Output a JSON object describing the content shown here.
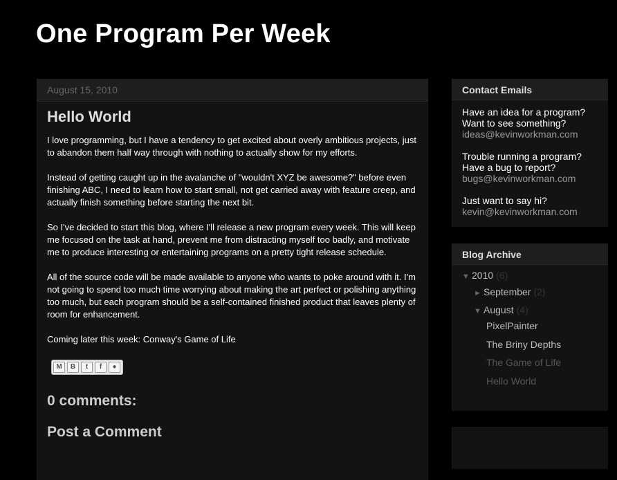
{
  "blog": {
    "title": "One Program Per Week"
  },
  "post": {
    "date": "August 15, 2010",
    "title": "Hello World",
    "paragraphs": [
      "I love programming, but I have a tendency to get excited about overly ambitious projects, just to abandon them half way through with nothing to actually show for my efforts.",
      "Instead of getting caught up in the avalanche of \"wouldn't XYZ be awesome?\" before even finishing ABC, I need to learn how to start small, not get carried away with feature creep, and actually finish something before starting the next bit.",
      "So I've decided to start this blog, where I'll release a new program every week. This will keep me focused on the task at hand, prevent me from distracting myself too badly, and motivate me to produce interesting or entertaining programs on a pretty tight release schedule.",
      "All of the source code will be made available to anyone who wants to poke around with it. I'm not going to spend too much time worrying about making the art perfect or polishing anything too much, but each program should be a self-contained finished product that leaves plenty of room for enhancement.",
      "Coming later this week: Conway's Game of Life"
    ],
    "share_icons": [
      "email-icon",
      "blogger-icon",
      "twitter-icon",
      "facebook-icon",
      "buzz-icon"
    ],
    "comments_heading": "0 comments:",
    "post_comment_heading": "Post a Comment"
  },
  "contact": {
    "title": "Contact Emails",
    "blocks": [
      {
        "line1": "Have an idea for a program?",
        "line2": "Want to see something?",
        "email": "ideas@kevinworkman.com"
      },
      {
        "line1": "Trouble running a program?",
        "line2": "Have a bug to report?",
        "email": "bugs@kevinworkman.com"
      },
      {
        "line1": "Just want to say hi?",
        "line2": "",
        "email": "kevin@kevinworkman.com"
      }
    ]
  },
  "archive": {
    "title": "Blog Archive",
    "year": {
      "label": "2010",
      "count": "(6)",
      "toggle": "▼"
    },
    "months": [
      {
        "label": "September",
        "count": "(2)",
        "toggle": "►"
      },
      {
        "label": "August",
        "count": "(4)",
        "toggle": "▼"
      }
    ],
    "posts": [
      "PixelPainter",
      "The Briny Depths",
      "The Game of Life",
      "Hello World"
    ]
  },
  "colors": {
    "background": "#000000",
    "panel": "#131313",
    "header_bar": "#1e1e1e",
    "email_text": "#999999"
  }
}
